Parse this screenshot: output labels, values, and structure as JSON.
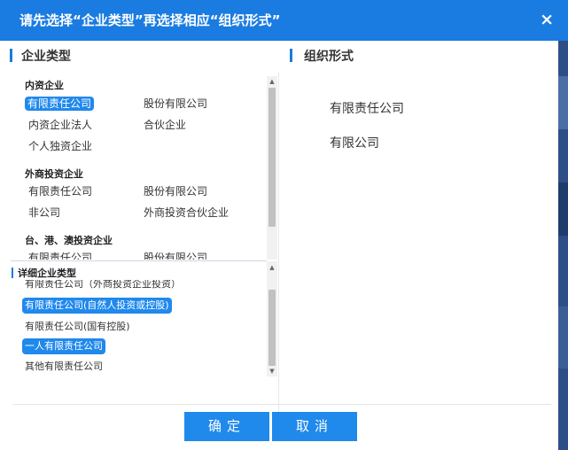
{
  "dialog": {
    "title": "请先选择“企业类型”再选择相应“组织形式”",
    "close_symbol": "×"
  },
  "left": {
    "heading": "企业类型",
    "groups": [
      {
        "name": "内资企业",
        "items": [
          "有限责任公司",
          "股份有限公司",
          "内资企业法人",
          "合伙企业",
          "个人独资企业"
        ]
      },
      {
        "name": "外商投资企业",
        "items": [
          "有限责任公司",
          "股份有限公司",
          "非公司",
          "外商投资合伙企业"
        ]
      },
      {
        "name": "台、港、澳投资企业",
        "items": [
          "有限责任公司",
          "股份有限公司"
        ]
      }
    ],
    "selected": "有限责任公司"
  },
  "detail": {
    "heading": "详细企业类型",
    "items": [
      "有限责任公司（外商投资企业投资）",
      "有限责任公司(自然人投资或控股)",
      "有限责任公司(国有控股)",
      "一人有限责任公司",
      "其他有限责任公司"
    ],
    "selected": [
      "有限责任公司(自然人投资或控股)",
      "一人有限责任公司"
    ]
  },
  "right": {
    "heading": "组织形式",
    "items": [
      "有限责任公司",
      "有限公司"
    ]
  },
  "buttons": {
    "ok": "确定",
    "cancel": "取消"
  },
  "colors": {
    "accent": "#1a7ce0",
    "selected_bg": "#2089ec"
  }
}
